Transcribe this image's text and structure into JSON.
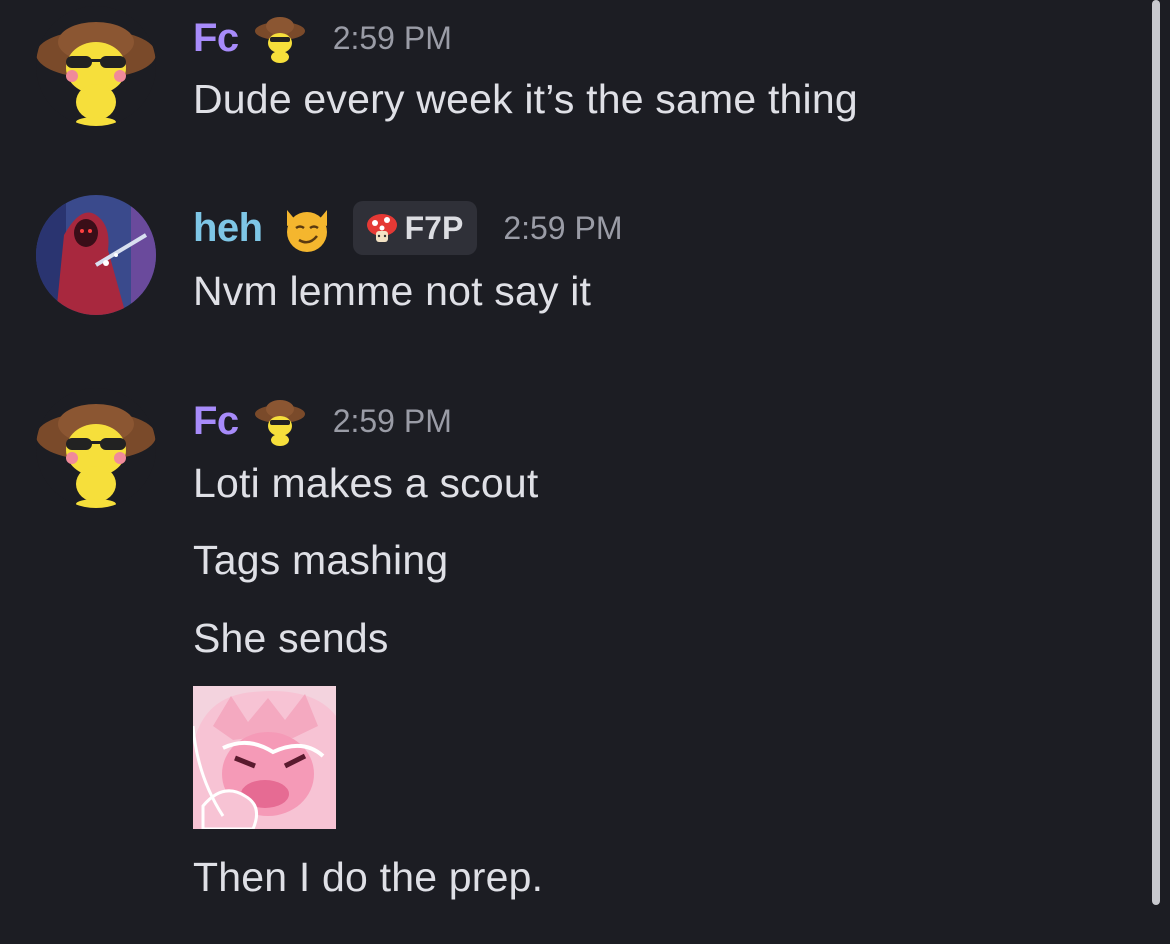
{
  "messages": [
    {
      "username": "Fc",
      "username_color": "#a78bfa",
      "name_icon": "pikachu-hat-icon",
      "timestamp": "2:59 PM",
      "avatar": "pikachu-sunglasses-avatar",
      "lines": [
        "Dude every week it’s the same thing"
      ]
    },
    {
      "username": "heh",
      "username_color": "#7ec6e6",
      "name_icon": "smirking-cat-icon",
      "tag": {
        "icon": "mushroom-icon",
        "label": "F7P"
      },
      "timestamp": "2:59 PM",
      "avatar": "hooded-figure-avatar",
      "lines": [
        "Nvm lemme not say it"
      ]
    },
    {
      "username": "Fc",
      "username_color": "#a78bfa",
      "name_icon": "pikachu-hat-icon",
      "timestamp": "2:59 PM",
      "avatar": "pikachu-sunglasses-avatar",
      "lines": [
        "Loti makes a scout",
        "Tags mashing",
        "She sends"
      ],
      "sticker": "pink-thinking-emote-sticker",
      "after_sticker": "Then I do the prep."
    }
  ],
  "colors": {
    "background": "#1c1d23",
    "text": "#dfe0e6",
    "timestamp": "#9a9ca6",
    "badge_bg": "#2f3038"
  }
}
